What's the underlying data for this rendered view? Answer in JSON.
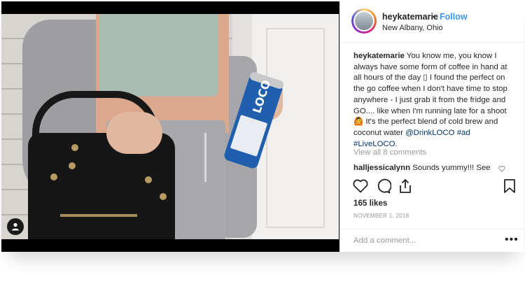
{
  "header": {
    "username": "heykatemarie",
    "separator": "•",
    "follow_label": "Follow",
    "location": "New Albany, Ohio"
  },
  "caption": {
    "username": "heykatemarie",
    "text_before": " You know me, you know I always have some form of coffee in hand at all hours of the day ▯ I found the perfect on the go coffee when I don't have time to stop anywhere - I just grab it from the fridge and GO.... like when I'm running late for a shoot 🙆 It's the perfect blend of cold brew and coconut water ",
    "mention": "@DrinkLOCO",
    "hashtag1": "#ad",
    "hashtag2": "#LiveLOCO",
    "end": "."
  },
  "comments": {
    "view_all_label": "View all 8 comments",
    "first": {
      "username": "halljessicalynn",
      "text": " Sounds yummy!!! See"
    }
  },
  "likes_label": "165 likes",
  "date_label": "NOVEMBER 1, 2018",
  "add_comment_placeholder": "Add a comment...",
  "more_label": "•••",
  "photo": {
    "can_text": "LOCO"
  },
  "icons": {
    "like": "heart-icon",
    "comment": "comment-icon",
    "share": "share-icon",
    "save": "bookmark-icon",
    "user": "user-icon",
    "comment_like": "small-heart-icon"
  },
  "colors": {
    "link": "#3897f0",
    "tag": "#003569",
    "text": "#262626",
    "muted": "#999999"
  }
}
